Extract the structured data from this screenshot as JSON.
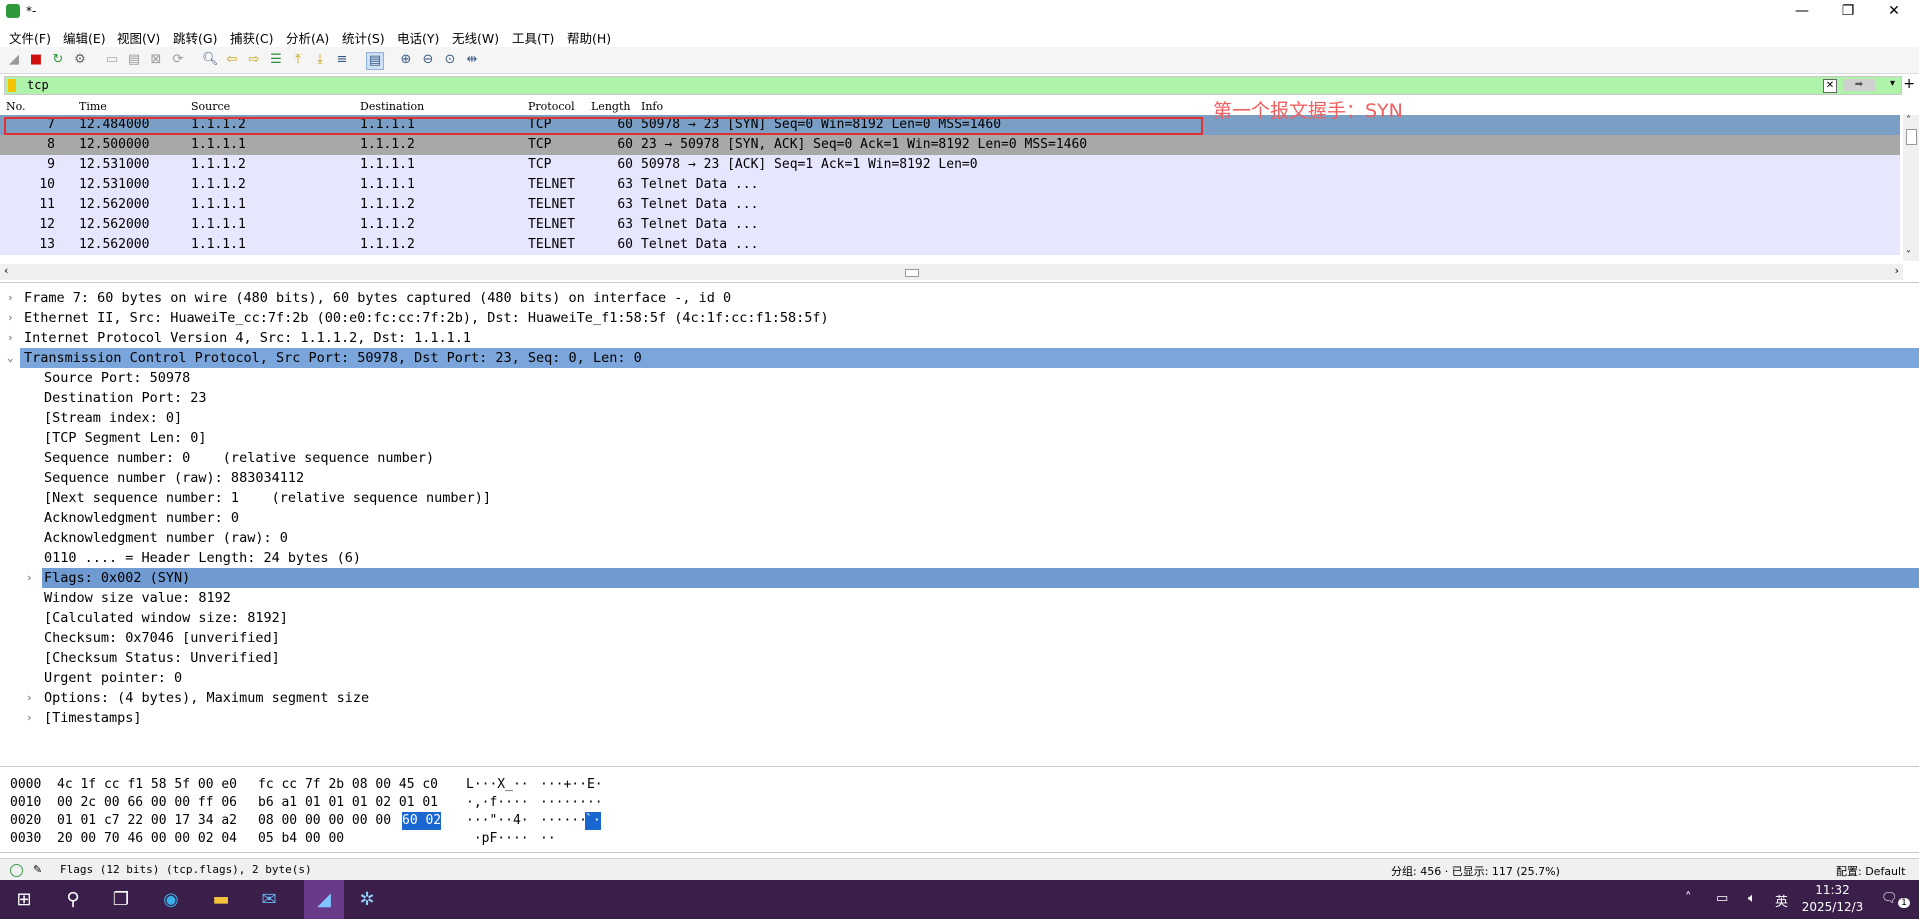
{
  "window": {
    "title": "*-",
    "icon": "shark-fin-icon"
  },
  "menu": [
    "文件(F)",
    "编辑(E)",
    "视图(V)",
    "跳转(G)",
    "捕获(C)",
    "分析(A)",
    "统计(S)",
    "电话(Y)",
    "无线(W)",
    "工具(T)",
    "帮助(H)"
  ],
  "filter": {
    "value": "tcp"
  },
  "packet_list": {
    "columns": [
      "No.",
      "Time",
      "Source",
      "Destination",
      "Protocol",
      "Length",
      "Info"
    ],
    "rows": [
      {
        "no": "7",
        "time": "12.484000",
        "src": "1.1.1.2",
        "dst": "1.1.1.1",
        "proto": "TCP",
        "len": "60",
        "info": "50978 → 23 [SYN] Seq=0 Win=8192 Len=0 MSS=1460"
      },
      {
        "no": "8",
        "time": "12.500000",
        "src": "1.1.1.1",
        "dst": "1.1.1.2",
        "proto": "TCP",
        "len": "60",
        "info": "23 → 50978 [SYN, ACK] Seq=0 Ack=1 Win=8192 Len=0 MSS=1460"
      },
      {
        "no": "9",
        "time": "12.531000",
        "src": "1.1.1.2",
        "dst": "1.1.1.1",
        "proto": "TCP",
        "len": "60",
        "info": "50978 → 23 [ACK] Seq=1 Ack=1 Win=8192 Len=0"
      },
      {
        "no": "10",
        "time": "12.531000",
        "src": "1.1.1.2",
        "dst": "1.1.1.1",
        "proto": "TELNET",
        "len": "63",
        "info": "Telnet Data ..."
      },
      {
        "no": "11",
        "time": "12.562000",
        "src": "1.1.1.1",
        "dst": "1.1.1.2",
        "proto": "TELNET",
        "len": "63",
        "info": "Telnet Data ..."
      },
      {
        "no": "12",
        "time": "12.562000",
        "src": "1.1.1.1",
        "dst": "1.1.1.2",
        "proto": "TELNET",
        "len": "63",
        "info": "Telnet Data ..."
      },
      {
        "no": "13",
        "time": "12.562000",
        "src": "1.1.1.1",
        "dst": "1.1.1.2",
        "proto": "TELNET",
        "len": "60",
        "info": "Telnet Data ..."
      }
    ],
    "annotation": "第一个报文握手：SYN"
  },
  "details": [
    {
      "indent": 0,
      "expander": "›",
      "text": "Frame 7: 60 bytes on wire (480 bits), 60 bytes captured (480 bits) on interface -, id 0"
    },
    {
      "indent": 0,
      "expander": "›",
      "text": "Ethernet II, Src: HuaweiTe_cc:7f:2b (00:e0:fc:cc:7f:2b), Dst: HuaweiTe_f1:58:5f (4c:1f:cc:f1:58:5f)"
    },
    {
      "indent": 0,
      "expander": "›",
      "text": "Internet Protocol Version 4, Src: 1.1.1.2, Dst: 1.1.1.1"
    },
    {
      "indent": 0,
      "expander": "⌄",
      "text": "Transmission Control Protocol, Src Port: 50978, Dst Port: 23, Seq: 0, Len: 0",
      "selected": "dark"
    },
    {
      "indent": 1,
      "expander": "",
      "text": "Source Port: 50978"
    },
    {
      "indent": 1,
      "expander": "",
      "text": "Destination Port: 23"
    },
    {
      "indent": 1,
      "expander": "",
      "text": "[Stream index: 0]"
    },
    {
      "indent": 1,
      "expander": "",
      "text": "[TCP Segment Len: 0]"
    },
    {
      "indent": 1,
      "expander": "",
      "text": "Sequence number: 0    (relative sequence number)"
    },
    {
      "indent": 1,
      "expander": "",
      "text": "Sequence number (raw): 883034112"
    },
    {
      "indent": 1,
      "expander": "",
      "text": "[Next sequence number: 1    (relative sequence number)]"
    },
    {
      "indent": 1,
      "expander": "",
      "text": "Acknowledgment number: 0"
    },
    {
      "indent": 1,
      "expander": "",
      "text": "Acknowledgment number (raw): 0"
    },
    {
      "indent": 1,
      "expander": "",
      "text": "0110 .... = Header Length: 24 bytes (6)"
    },
    {
      "indent": 1,
      "expander": "›",
      "text": "Flags: 0x002 (SYN)",
      "selected": "light"
    },
    {
      "indent": 1,
      "expander": "",
      "text": "Window size value: 8192"
    },
    {
      "indent": 1,
      "expander": "",
      "text": "[Calculated window size: 8192]"
    },
    {
      "indent": 1,
      "expander": "",
      "text": "Checksum: 0x7046 [unverified]"
    },
    {
      "indent": 1,
      "expander": "",
      "text": "[Checksum Status: Unverified]"
    },
    {
      "indent": 1,
      "expander": "",
      "text": "Urgent pointer: 0"
    },
    {
      "indent": 1,
      "expander": "›",
      "text": "Options: (4 bytes), Maximum segment size"
    },
    {
      "indent": 1,
      "expander": "›",
      "text": "[Timestamps]"
    }
  ],
  "bytes": [
    {
      "offset": "0000",
      "hex1": "4c 1f cc f1 58 5f 00 e0",
      "hex2": "fc cc 7f 2b 08 00 45 c0",
      "hex2hl": "",
      "ascii1": "L···X_··",
      "ascii2": "···+··E·",
      "ascii2hl": ""
    },
    {
      "offset": "0010",
      "hex1": "00 2c 00 66 00 00 ff 06",
      "hex2": "b6 a1 01 01 01 02 01 01",
      "hex2hl": "",
      "ascii1": "·,·f····",
      "ascii2": "········",
      "ascii2hl": ""
    },
    {
      "offset": "0020",
      "hex1": "01 01 c7 22 00 17 34 a2",
      "hex2": "08 00 00 00 00 00 ",
      "hex2hl": "60 02",
      "ascii1": "···\"··4·",
      "ascii2": "······",
      "ascii2hl": "`·"
    },
    {
      "offset": "0030",
      "hex1": "20 00 70 46 00 00 02 04",
      "hex2": "05 b4 00 00",
      "hex2hl": "",
      "ascii1": " ·pF····",
      "ascii2": "··",
      "ascii2hl": ""
    }
  ],
  "status": {
    "field": "Flags (12 bits) (tcp.flags), 2 byte(s)",
    "packets": "分组: 456 · 已显示: 117 (25.7%)",
    "profile": "配置: Default"
  },
  "taskbar": {
    "ime": "英",
    "time": "11:32",
    "date": "2025/12/3",
    "notifications": "1"
  }
}
